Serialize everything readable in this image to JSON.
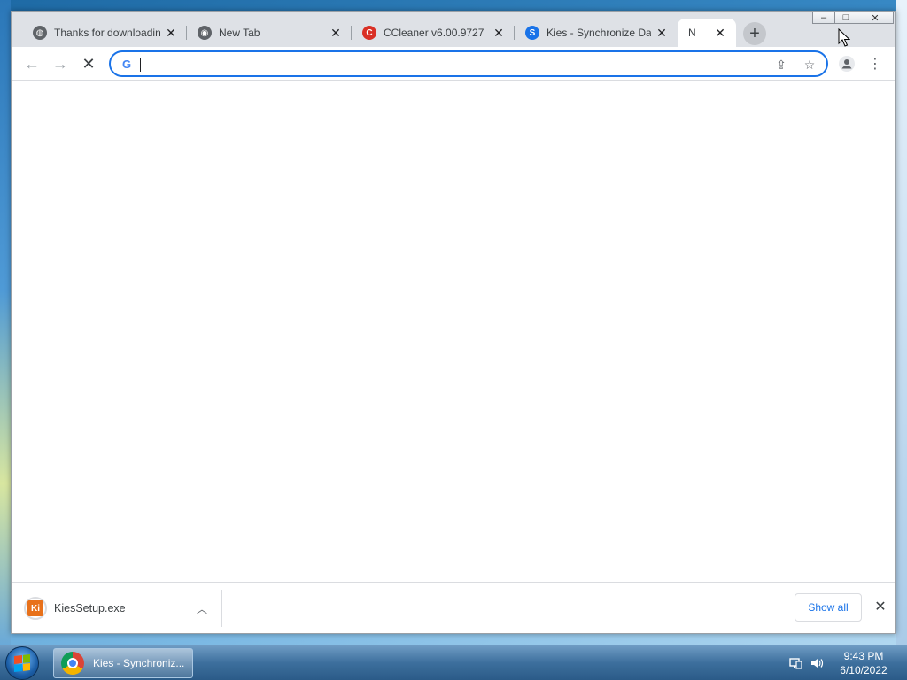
{
  "browser": {
    "tabs": [
      {
        "title": "Thanks for downloading",
        "favicon": "globe-icon"
      },
      {
        "title": "New Tab",
        "favicon": "chrome-icon"
      },
      {
        "title": "CCleaner v6.00.9727",
        "favicon": "ccleaner-icon"
      },
      {
        "title": "Kies - Synchronize Data",
        "favicon": "s-icon"
      },
      {
        "title": "N",
        "favicon": "loading-icon",
        "active": true
      }
    ],
    "new_tab_symbol": "+",
    "address_bar": {
      "value": "",
      "placeholder": "",
      "search_engine_icon": "G"
    },
    "window_controls": {
      "minimize": "–",
      "maximize": "□",
      "close": "✕"
    }
  },
  "download_bar": {
    "item": {
      "file_name": "KiesSetup.exe",
      "icon_text": "Ki"
    },
    "show_all_label": "Show all"
  },
  "taskbar": {
    "task_label": "Kies - Synchroniz...",
    "clock_time": "9:43 PM",
    "clock_date": "6/10/2022"
  },
  "colors": {
    "accent": "#1a73e8",
    "tabstrip": "#dee1e6",
    "taskbar": "#3d6f9d"
  }
}
